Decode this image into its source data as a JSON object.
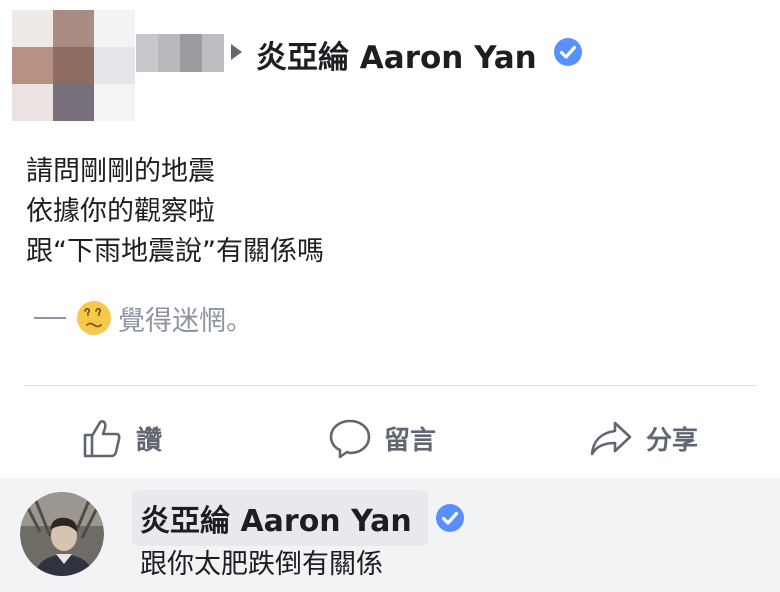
{
  "post": {
    "page_name": "炎亞綸 Aaron Yan",
    "lines": [
      "請問剛剛的地震",
      "依據你的觀察啦",
      "跟“下雨地震說”有關係嗎"
    ],
    "feeling": "覺得迷惘。"
  },
  "actions": {
    "like": "讚",
    "comment": "留言",
    "share": "分享"
  },
  "comment": {
    "author": "炎亞綸 Aaron Yan",
    "text": "跟你太肥跌倒有關係"
  },
  "icons": {
    "caret": "caret-right-icon",
    "verified": "verified-badge-icon",
    "feeling": "confused-emoji-icon",
    "like": "thumbs-up-icon",
    "comment": "speech-bubble-icon",
    "share": "share-arrow-icon"
  },
  "colors": {
    "verified": "#5890ff",
    "action_text": "#606770",
    "muted": "#8d949e"
  }
}
